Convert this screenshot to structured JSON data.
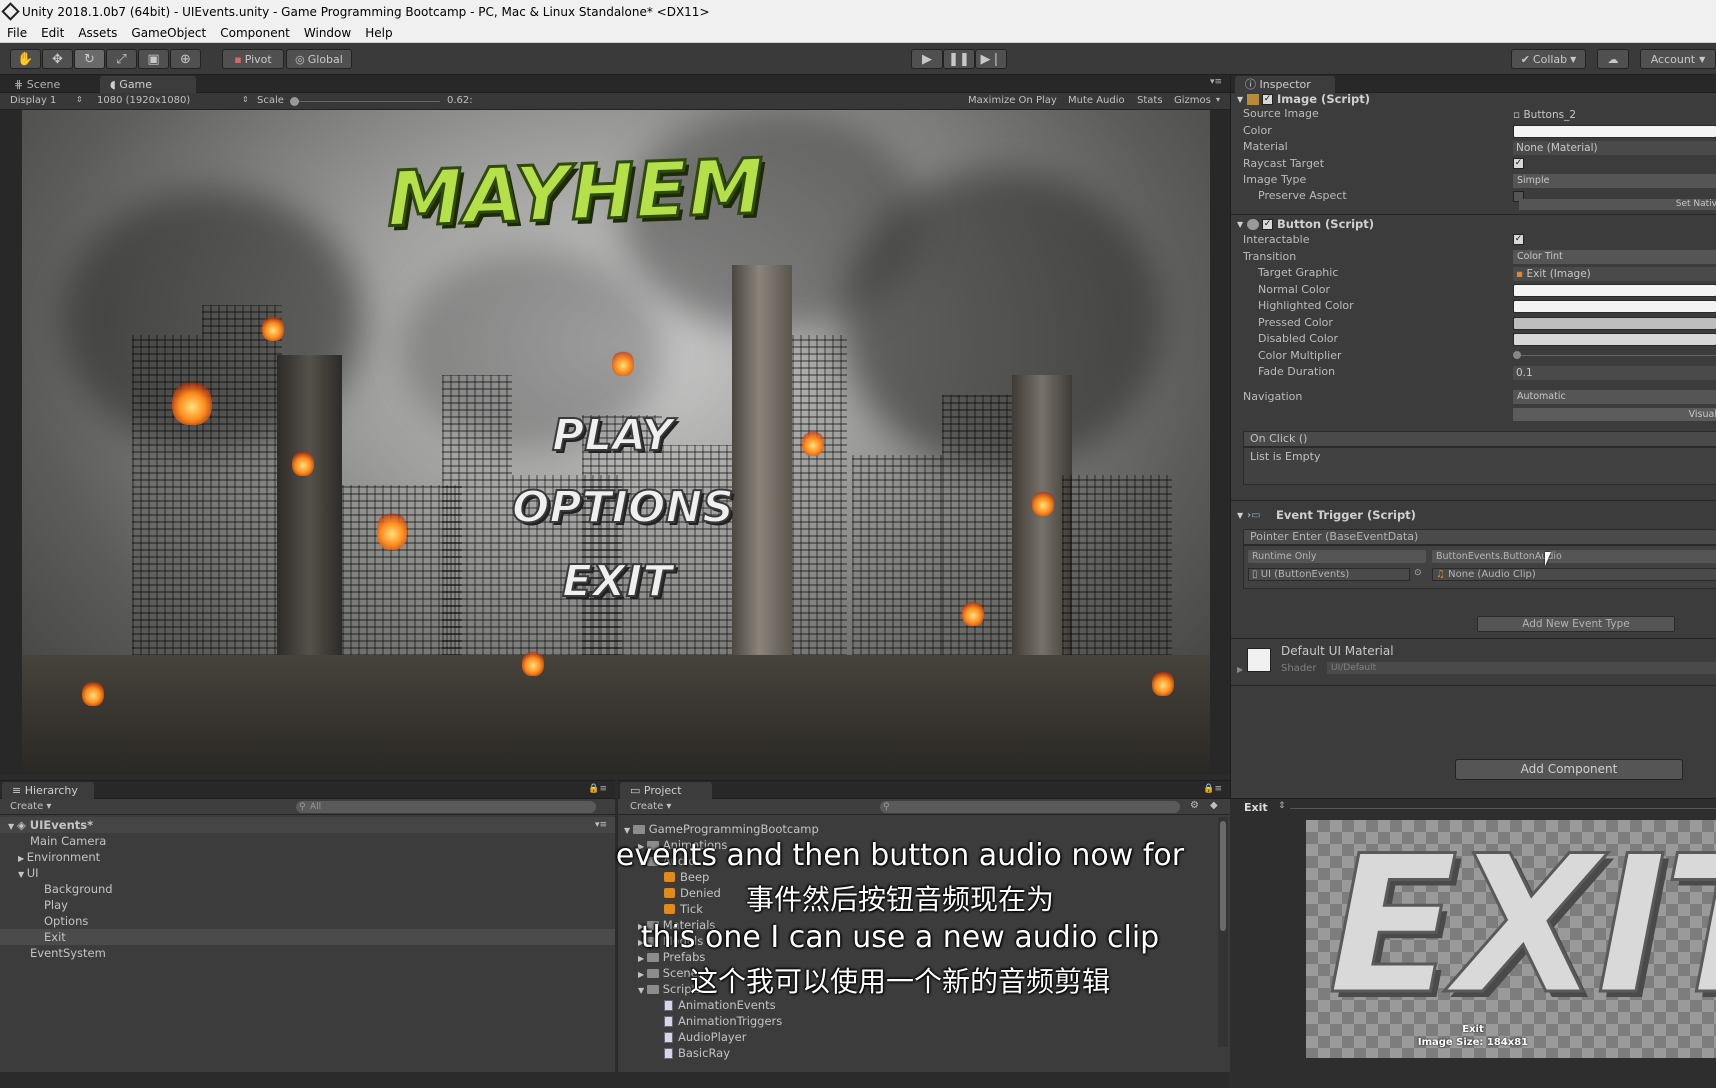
{
  "window_title": "Unity 2018.1.0b7 (64bit) - UIEvents.unity - Game Programming Bootcamp - PC, Mac & Linux Standalone* <DX11>",
  "menu": [
    "File",
    "Edit",
    "Assets",
    "GameObject",
    "Component",
    "Window",
    "Help"
  ],
  "toolbar": {
    "pivot": "Pivot",
    "global": "Global",
    "collab": "Collab",
    "account": "Account"
  },
  "scene_tabs": {
    "scene": "Scene",
    "game": "Game"
  },
  "game_bar": {
    "display": "Display 1",
    "resolution": "1080 (1920x1080)",
    "scale_label": "Scale",
    "scale_value": "0.62:",
    "maximize": "Maximize On Play",
    "mute": "Mute Audio",
    "stats": "Stats",
    "gizmos": "Gizmos"
  },
  "game": {
    "title": "MAYHEM",
    "menu_items": [
      "PLAY",
      "OPTIONS",
      "EXIT"
    ]
  },
  "inspector": {
    "tab": "Inspector",
    "image_component": "Image (Script)",
    "image_props": [
      {
        "label": "Source Image",
        "value": "Buttons_2"
      },
      {
        "label": "Color",
        "value": ""
      },
      {
        "label": "Material",
        "value": "None (Material)"
      },
      {
        "label": "Raycast Target",
        "value": "✓"
      },
      {
        "label": "Image Type",
        "value": "Simple"
      },
      {
        "label": "Preserve Aspect",
        "value": ""
      }
    ],
    "set_native": "Set Nativ",
    "button_component": "Button (Script)",
    "button_props": [
      {
        "label": "Interactable",
        "value": "✓"
      },
      {
        "label": "Transition",
        "value": "Color Tint"
      },
      {
        "label": "Target Graphic",
        "value": "Exit (Image)"
      },
      {
        "label": "Normal Color",
        "value": ""
      },
      {
        "label": "Highlighted Color",
        "value": ""
      },
      {
        "label": "Pressed Color",
        "value": ""
      },
      {
        "label": "Disabled Color",
        "value": ""
      },
      {
        "label": "Color Multiplier",
        "value": ""
      },
      {
        "label": "Fade Duration",
        "value": "0.1"
      }
    ],
    "navigation_label": "Navigation",
    "navigation_value": "Automatic",
    "visualize": "Visual",
    "on_click": "On Click ()",
    "list_empty": "List is Empty",
    "event_trigger": "Event Trigger (Script)",
    "pointer_enter": "Pointer Enter (BaseEventData)",
    "runtime_only": "Runtime Only",
    "function": "ButtonEvents.ButtonAudio",
    "target_object": "UI (ButtonEvents)",
    "audio_clip": "None (Audio Clip)",
    "add_event_type": "Add New Event Type",
    "material_name": "Default UI Material",
    "shader_label": "Shader",
    "shader_value": "UI/Default",
    "add_component": "Add Component"
  },
  "hierarchy": {
    "tab": "Hierarchy",
    "create": "Create",
    "search": "All",
    "scene": "UIEvents*",
    "items": [
      "Main Camera",
      "Environment",
      "UI",
      "Background",
      "Play",
      "Options",
      "Exit",
      "EventSystem"
    ]
  },
  "project": {
    "tab": "Project",
    "create": "Create",
    "root": "GameProgrammingBootcamp",
    "folders_top": [
      "Animations",
      "Audio"
    ],
    "audio_items": [
      "Beep",
      "Denied",
      "Tick"
    ],
    "folders_mid": [
      "Materials",
      "Models",
      "Prefabs",
      "Scenes",
      "Scripts"
    ],
    "scripts": [
      "AnimationEvents",
      "AnimationTriggers",
      "AudioPlayer",
      "BasicRay"
    ]
  },
  "preview": {
    "title": "Exit",
    "image_text": "EXIT",
    "caption_name": "Exit",
    "caption_size": "Image Size: 184x81"
  },
  "subtitles": {
    "en1": "events and then button audio now for",
    "zh1": "事件然后按钮音频现在为",
    "en2": "this one I can use a new audio clip",
    "zh2": "这个我可以使用一个新的音频剪辑"
  }
}
